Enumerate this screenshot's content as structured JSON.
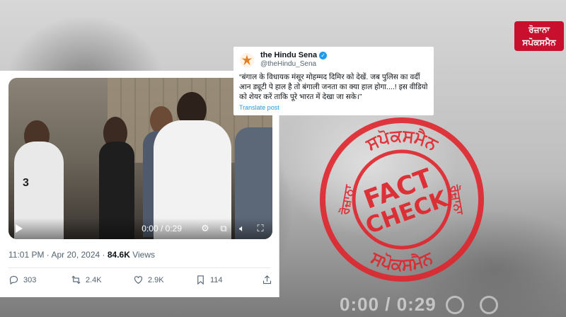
{
  "logo": {
    "line1": "ਰੋਜ਼ਾਨਾ",
    "line2": "ਸਪੋਕਸਮੈਨ"
  },
  "tweet": {
    "author_name": "the Hindu Sena",
    "handle": "@theHindu_Sena",
    "text": "“बंगाल के विधायक मंसूर मोहम्मद दिमिर को देखें.  जब पुलिस का वर्दी आन ड्यूटी पे हाल है तो बंगाली जनता का क्या हाल होगा....! इस वीडियो को शेयर करें ताकि पूरे भारत में देखा जा सके।”",
    "translate_label": "Translate post",
    "video_time": "0:00 / 0:29",
    "timestamp": "11:01 PM · Apr 20, 2024 · ",
    "views_count": "84.6K",
    "views_label": " Views",
    "jersey_number": "3",
    "replies": "303",
    "reposts": "2.4K",
    "likes": "2.9K",
    "bookmarks": "114"
  },
  "stamp": {
    "word1": "FACT",
    "word2": "CHECK",
    "ring_top": "ਸਪੋਕਸਮੈਨ",
    "ring_bottom": "ਸਪੋਕਸਮੈਨ",
    "ring_left": "ਰੋਜ਼ਾਨਾ",
    "ring_right": "ਰੋਜ਼ਾਨਾ",
    "color": "#e0242b"
  },
  "background": {
    "video_time": "0:00 / 0:29"
  }
}
